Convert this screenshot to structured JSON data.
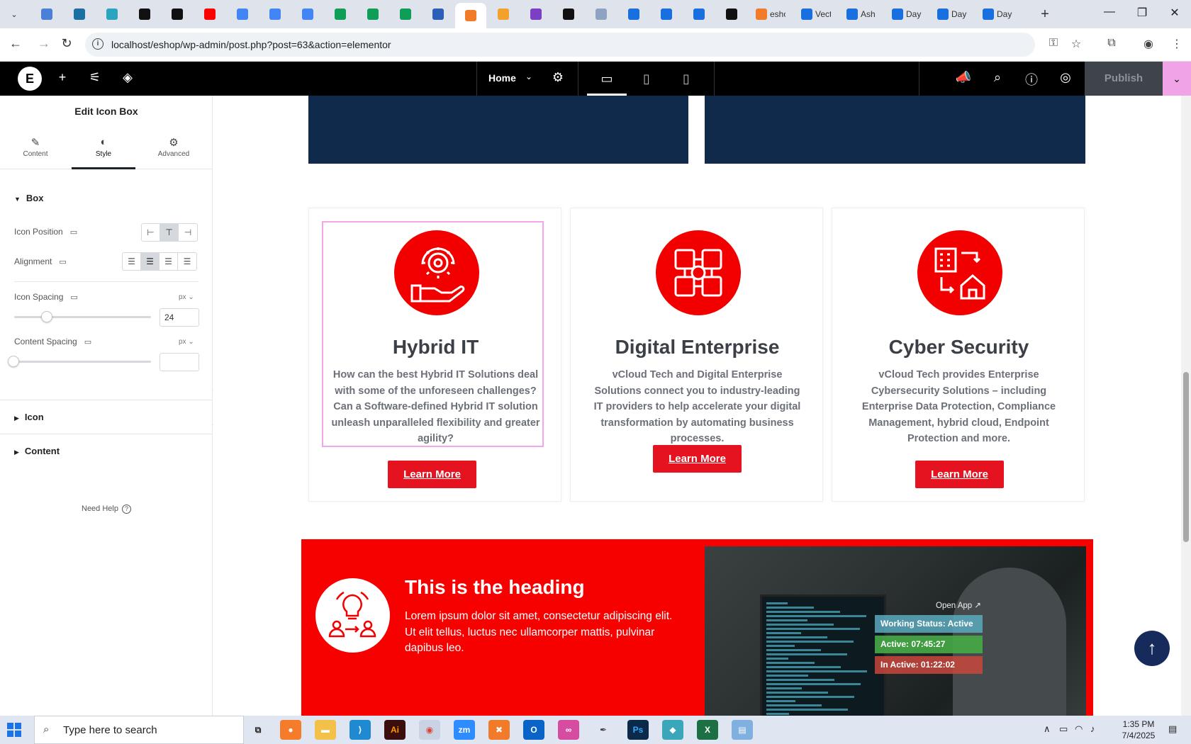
{
  "browser": {
    "tabs": [
      {
        "icon": "edge-icon",
        "color": "#4c7fd8",
        "title": ""
      },
      {
        "icon": "vpn-icon",
        "color": "#1c6fa1",
        "title": ""
      },
      {
        "icon": "extension-icon",
        "color": "#2aa4bf",
        "title": ""
      },
      {
        "icon": "threads-icon",
        "color": "#111111",
        "title": ""
      },
      {
        "icon": "bolt-icon",
        "color": "#111111",
        "title": ""
      },
      {
        "icon": "youtube-icon",
        "color": "#ff0000",
        "title": ""
      },
      {
        "icon": "docs-icon",
        "color": "#4285f4",
        "title": ""
      },
      {
        "icon": "docs-icon",
        "color": "#4285f4",
        "title": ""
      },
      {
        "icon": "docs-icon",
        "color": "#4285f4",
        "title": ""
      },
      {
        "icon": "sheets-icon",
        "color": "#0f9d58",
        "title": ""
      },
      {
        "icon": "sheets-icon",
        "color": "#0f9d58",
        "title": ""
      },
      {
        "icon": "sheets-icon",
        "color": "#0f9d58",
        "title": ""
      },
      {
        "icon": "word-icon",
        "color": "#2b5fb8",
        "title": ""
      },
      {
        "icon": "xampp-icon",
        "color": "#f27b2a",
        "title": ""
      },
      {
        "icon": "lion-icon",
        "color": "#f3a12d",
        "title": ""
      },
      {
        "icon": "regex-icon",
        "color": "#7a3fc4",
        "title": ""
      },
      {
        "icon": "code-icon",
        "color": "#111111",
        "title": ""
      },
      {
        "icon": "grid-icon",
        "color": "#8ea3c3",
        "title": ""
      },
      {
        "icon": "forms-icon",
        "color": "#1a6fe0",
        "title": ""
      },
      {
        "icon": "forms-icon",
        "color": "#1a6fe0",
        "title": ""
      },
      {
        "icon": "forms-icon",
        "color": "#1a6fe0",
        "title": ""
      },
      {
        "icon": "medium-icon",
        "color": "#111111",
        "title": ""
      },
      {
        "icon": "xampp-icon",
        "color": "#f27b2a",
        "title": "esho"
      },
      {
        "icon": "forms-icon",
        "color": "#1a6fe0",
        "title": "Vect"
      },
      {
        "icon": "forms-icon",
        "color": "#1a6fe0",
        "title": "Ash"
      },
      {
        "icon": "forms-icon",
        "color": "#1a6fe0",
        "title": "Day"
      },
      {
        "icon": "forms-icon",
        "color": "#1a6fe0",
        "title": "Day"
      },
      {
        "icon": "forms-icon",
        "color": "#1a6fe0",
        "title": "Day"
      }
    ],
    "url": "localhost/eshop/wp-admin/post.php?post=63&action=elementor"
  },
  "editor": {
    "page_name": "Home",
    "publish_label": "Publish"
  },
  "panel": {
    "title": "Edit Icon Box",
    "tabs": {
      "content": "Content",
      "style": "Style",
      "advanced": "Advanced"
    },
    "box_section": "Box",
    "icon_position_label": "Icon Position",
    "alignment_label": "Alignment",
    "icon_spacing_label": "Icon Spacing",
    "icon_spacing_unit": "px",
    "icon_spacing_value": "24",
    "icon_spacing_slider": 0.24,
    "content_spacing_label": "Content Spacing",
    "content_spacing_unit": "px",
    "content_spacing_value": "",
    "icon_section": "Icon",
    "content_section": "Content",
    "need_help": "Need Help"
  },
  "canvas": {
    "cards": [
      {
        "title": "Hybrid IT",
        "text": "How can the best Hybrid IT Solutions deal with some of the unforeseen challenges? Can a Software-defined Hybrid IT solution unleash unparalleled flexibility and greater agility?",
        "button": "Learn More"
      },
      {
        "title": "Digital Enterprise",
        "text": "vCloud Tech and Digital Enterprise Solutions connect you to industry-leading IT providers to help accelerate your digital transformation by automating business processes.",
        "button": "Learn More"
      },
      {
        "title": "Cyber Security",
        "text": "vCloud Tech provides Enterprise Cybersecurity Solutions – including Enterprise Data Protection, Compliance Management, hybrid cloud, Endpoint Protection and more.",
        "button": "Learn More"
      }
    ],
    "red_section": {
      "heading": "This is the heading",
      "text": "Lorem ipsum dolor sit amet, consectetur adipiscing elit. Ut elit tellus, luctus nec ullamcorper mattis, pulvinar dapibus leo."
    },
    "widget": {
      "open_app": "Open App ↗",
      "working_status": "Working Status: Active",
      "active": "Active: 07:45:27",
      "inactive": "In Active: 01:22:02"
    }
  },
  "taskbar": {
    "search_placeholder": "Type here to search",
    "time": "1:35 PM",
    "date": "7/4/2025"
  },
  "colors": {
    "accent_red": "#f20000",
    "button_red": "#e4131f",
    "navy": "#0f2a4a",
    "selection_pink": "#f3a6ea"
  }
}
